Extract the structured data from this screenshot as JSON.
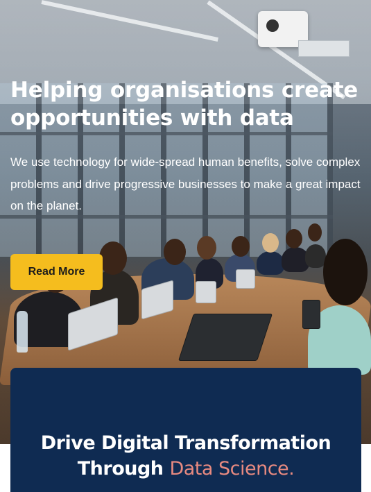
{
  "hero": {
    "title_line1": "Helping organisations create",
    "title_line2": "opportunities with data",
    "text": "We use technology for wide-spread human benefits, solve complex problems and drive progressive businesses to make a great impact on the planet.",
    "button_label": "Read More"
  },
  "card": {
    "title_line1": "Drive Digital Transformation",
    "title_line2_prefix": "Through ",
    "title_line2_accent": "Data Science."
  },
  "colors": {
    "button": "#f5bd1e",
    "card_background": "#0f2b52",
    "accent_text": "#e88a80"
  }
}
